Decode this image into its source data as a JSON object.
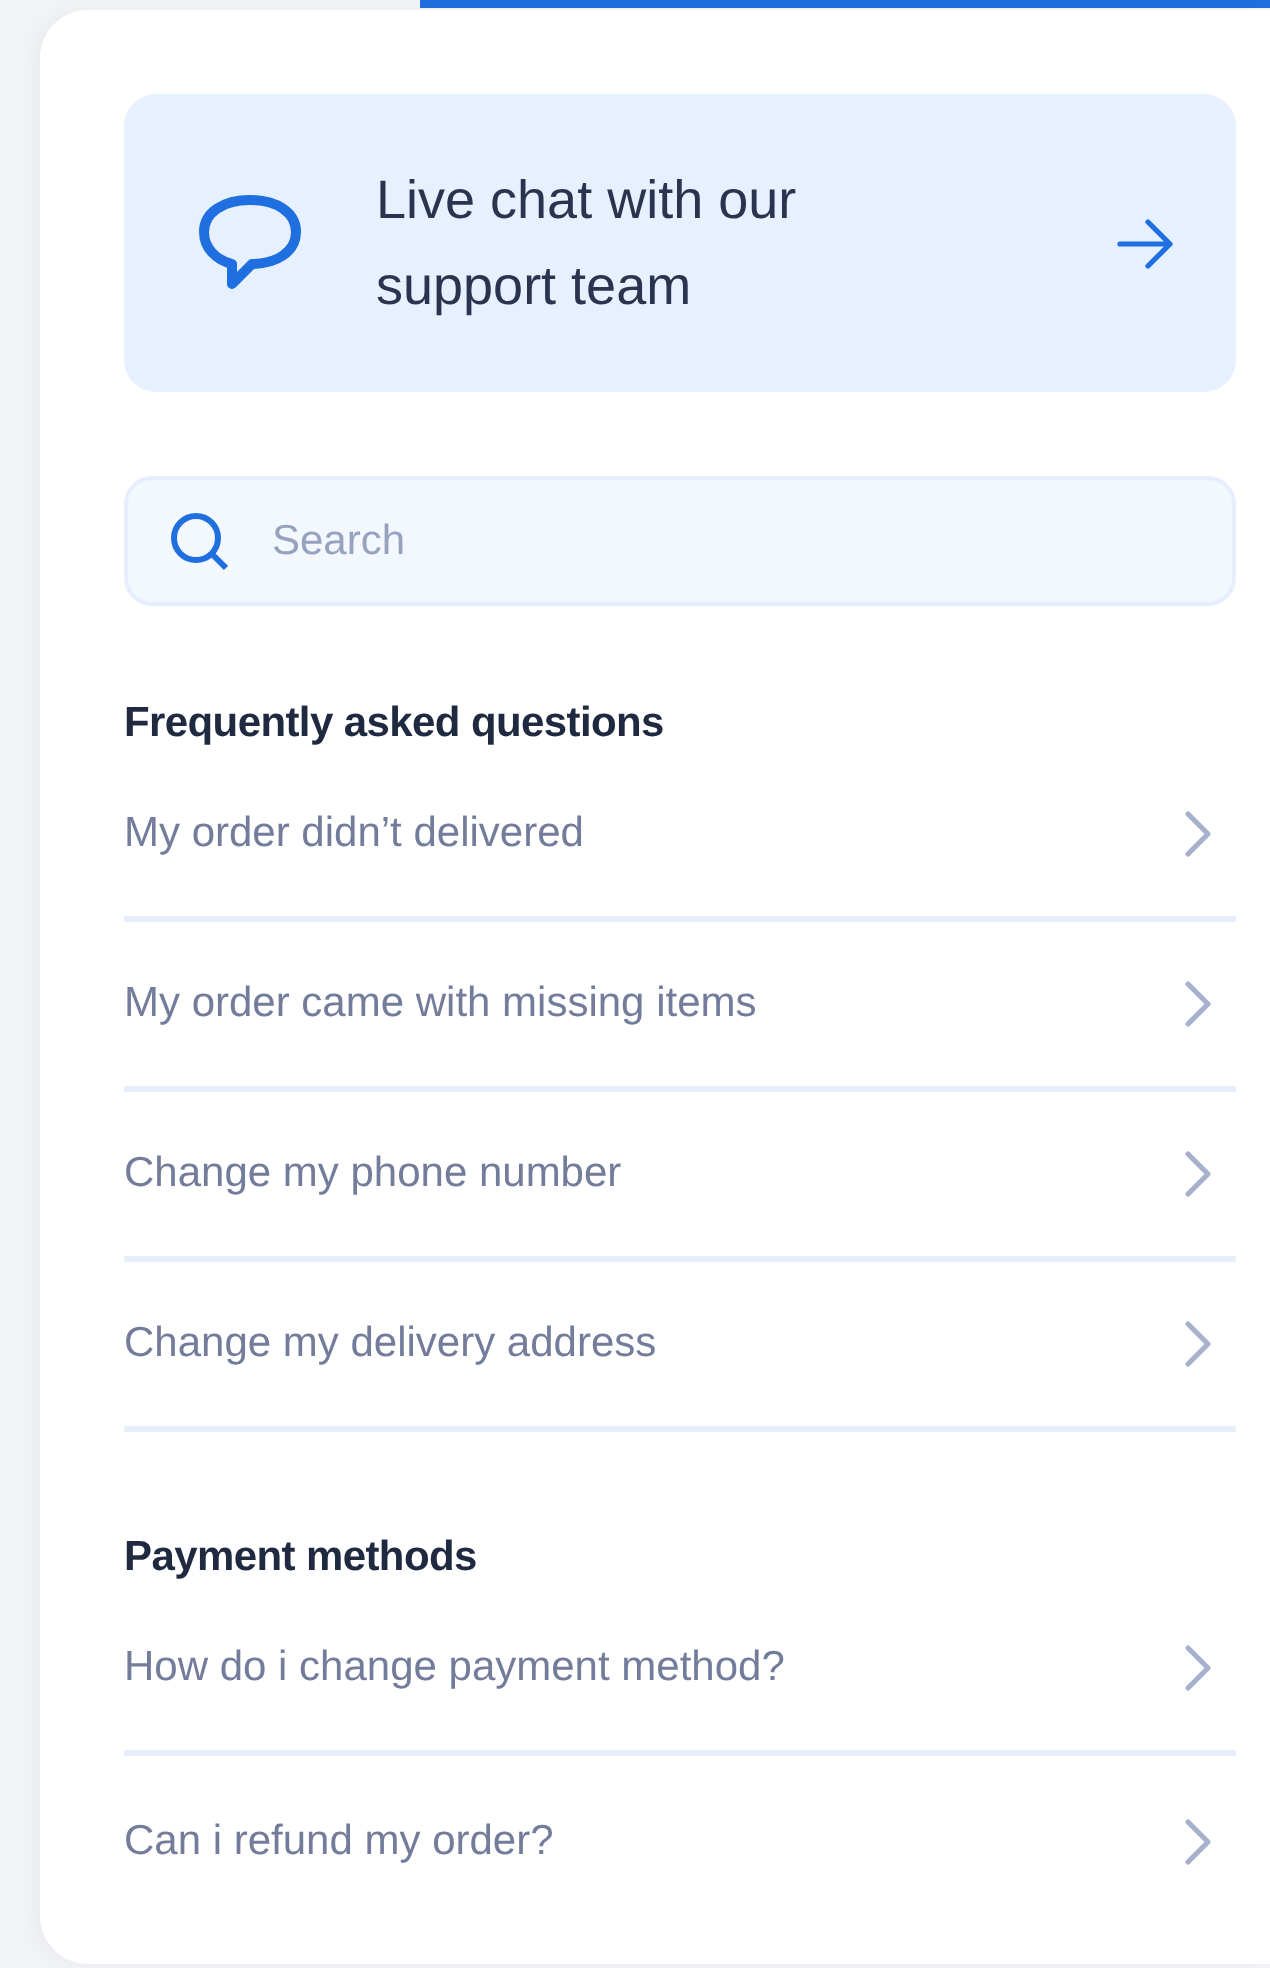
{
  "live_chat": {
    "label": "Live chat with our support team"
  },
  "search": {
    "placeholder": "Search"
  },
  "sections": [
    {
      "title": "Frequently asked questions",
      "items": [
        "My order didn’t delivered",
        "My order came with missing items",
        "Change my phone number",
        "Change my delivery address"
      ]
    },
    {
      "title": "Payment methods",
      "items": [
        "How do i change payment method?",
        "Can i refund my order?"
      ]
    }
  ]
}
